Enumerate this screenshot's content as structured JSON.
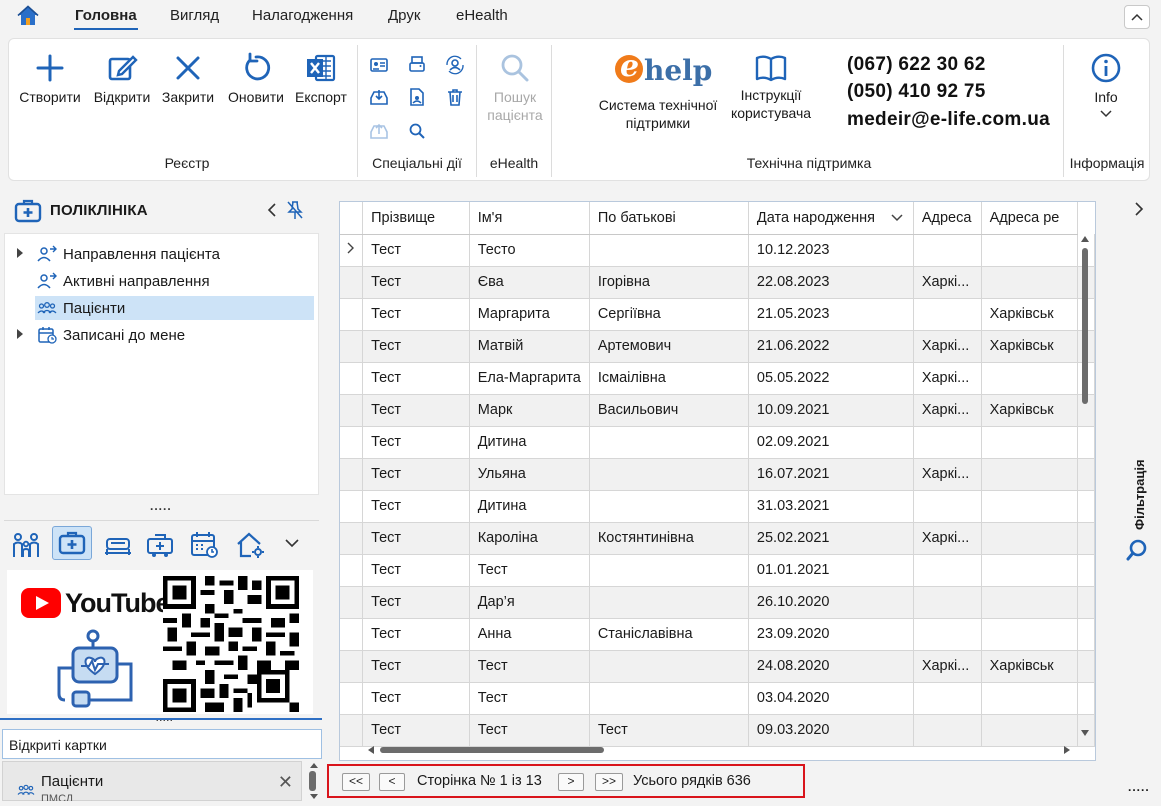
{
  "menu": {
    "tabs": [
      {
        "label": "Головна",
        "active": true
      },
      {
        "label": "Вигляд"
      },
      {
        "label": "Налагодження"
      },
      {
        "label": "Друк"
      },
      {
        "label": "eHealth"
      }
    ],
    "collapse_icon": "chevron-up-icon"
  },
  "ribbon": {
    "registry": {
      "buttons": [
        {
          "label": "Створити",
          "icon": "plus-icon"
        },
        {
          "label": "Відкрити",
          "icon": "edit-icon"
        },
        {
          "label": "Закрити",
          "icon": "close-icon"
        },
        {
          "label": "Оновити",
          "icon": "refresh-icon"
        },
        {
          "label": "Експорт",
          "icon": "excel-icon"
        }
      ],
      "group_label": "Реєстр"
    },
    "special": {
      "group_label": "Спеціальні дії"
    },
    "ehealth": {
      "search_label_1": "Пошук",
      "search_label_2": "пацієнта",
      "group_label": "eHealth"
    },
    "support": {
      "system_label_1": "Система технічної",
      "system_label_2": "підтримки",
      "instructions_label_1": "Інструкції",
      "instructions_label_2": "користувача",
      "phone_1": "(067) 622 30 62",
      "phone_2": "(050) 410 92 75",
      "email": "medeir@e-life.com.ua",
      "group_label": "Технічна підтримка",
      "logo_letter": "e",
      "logo_text": "help"
    },
    "info": {
      "label": "Info",
      "group_label": "Інформація"
    }
  },
  "left_panel": {
    "title": "ПОЛІКЛІНІКА",
    "tree": [
      {
        "label": "Направлення пацієнта",
        "expandable": true,
        "icon": "referral-icon"
      },
      {
        "label": "Активні направлення",
        "expandable": false,
        "icon": "referral-icon"
      },
      {
        "label": "Пацієнти",
        "expandable": false,
        "selected": true,
        "icon": "patients-icon"
      },
      {
        "label": "Записані до мене",
        "expandable": true,
        "icon": "calendar-icon"
      }
    ],
    "splitter_dots": ".....",
    "nav_icons": [
      "family-icon",
      "medical-kit-icon",
      "bed-icon",
      "ambulance-icon",
      "calendar-clock-icon",
      "home-settings-icon",
      "chevron-down-icon"
    ],
    "promo": {
      "youtube_text": "YouTube"
    },
    "open_cards": {
      "header": "Відкриті картки",
      "card_label": "Пацієнти",
      "card_sub": "ПМСД"
    }
  },
  "grid": {
    "columns": [
      "Прізвище",
      "Ім'я",
      "По батькові",
      "Дата народження",
      "Адреса",
      "Адреса ре"
    ],
    "rows": [
      [
        "Тест",
        "Тесто",
        "",
        "10.12.2023",
        "",
        ""
      ],
      [
        "Тест",
        "Єва",
        "Ігорівна",
        "22.08.2023",
        "Харкі...",
        ""
      ],
      [
        "Тест",
        "Маргарита",
        "Сергіївна",
        "21.05.2023",
        "",
        "Харківськ"
      ],
      [
        "Тест",
        "Матвій",
        "Артемович",
        "21.06.2022",
        "Харкі...",
        "Харківськ"
      ],
      [
        "Тест",
        "Ела-Маргарита",
        "Ісмаілівна",
        "05.05.2022",
        "Харкі...",
        ""
      ],
      [
        "Тест",
        "Марк",
        "Васильович",
        "10.09.2021",
        "Харкі...",
        "Харківськ"
      ],
      [
        "Тест",
        "Дитина",
        "",
        "02.09.2021",
        "",
        ""
      ],
      [
        "Тест",
        "Ульяна",
        "",
        "16.07.2021",
        "Харкі...",
        ""
      ],
      [
        "Тест",
        "Дитина",
        "",
        "31.03.2021",
        "",
        ""
      ],
      [
        "Тест",
        "Кароліна",
        "Костянтинівна",
        "25.02.2021",
        "Харкі...",
        ""
      ],
      [
        "Тест",
        "Тест",
        "",
        "01.01.2021",
        "",
        ""
      ],
      [
        "Тест",
        "Дар’я",
        "",
        "26.10.2020",
        "",
        ""
      ],
      [
        "Тест",
        "Анна",
        "Станіславівна",
        "23.09.2020",
        "",
        ""
      ],
      [
        "Тест",
        "Тест",
        "",
        "24.08.2020",
        "Харкі...",
        "Харківськ"
      ],
      [
        "Тест",
        "Тест",
        "",
        "03.04.2020",
        "",
        ""
      ],
      [
        "Тест",
        "Тест",
        "Тест",
        "09.03.2020",
        "",
        ""
      ]
    ]
  },
  "pager": {
    "first": "<<",
    "prev": "<",
    "page_text": "Сторінка № 1 із 13",
    "next": ">",
    "last": ">>",
    "total_text": "Усього рядків 636"
  },
  "right_bar": {
    "filter_label": "Фільтрація",
    "corner_dots": "....."
  },
  "colors": {
    "accent": "#1f64b8",
    "selection": "#cde3f7",
    "pager_border": "#d9141b",
    "ehelp_orange": "#f07b1a"
  }
}
